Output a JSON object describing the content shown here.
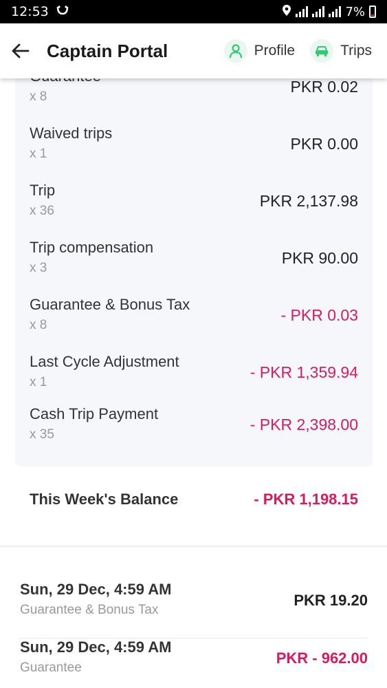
{
  "status_bar": {
    "time": "12:53",
    "battery": "7%"
  },
  "app_bar": {
    "title": "Captain Portal",
    "profile_label": "Profile",
    "trips_label": "Trips"
  },
  "breakdown": [
    {
      "label": "Guarantee",
      "count": "x 8",
      "amount": "PKR 0.02",
      "negative": false
    },
    {
      "label": "Waived trips",
      "count": "x 1",
      "amount": "PKR 0.00",
      "negative": false
    },
    {
      "label": "Trip",
      "count": "x 36",
      "amount": "PKR 2,137.98",
      "negative": false
    },
    {
      "label": "Trip compensation",
      "count": "x 3",
      "amount": "PKR 90.00",
      "negative": false
    },
    {
      "label": "Guarantee & Bonus Tax",
      "count": "x 8",
      "amount": "- PKR 0.03",
      "negative": true
    },
    {
      "label": "Last Cycle Adjustment",
      "count": "x 1",
      "amount": "- PKR 1,359.94",
      "negative": true
    },
    {
      "label": "Cash Trip Payment",
      "count": "x 35",
      "amount": "- PKR 2,398.00",
      "negative": true
    }
  ],
  "balance": {
    "label": "This Week's Balance",
    "amount": "- PKR 1,198.15"
  },
  "transactions": [
    {
      "date": "Sun, 29 Dec, 4:59 AM",
      "type": "Guarantee & Bonus Tax",
      "amount": "PKR 19.20",
      "negative": false
    },
    {
      "date": "Sun, 29 Dec, 4:59 AM",
      "type": "Guarantee",
      "amount": "PKR - 962.00",
      "negative": true
    }
  ],
  "colors": {
    "accent_green": "#2ecc71",
    "negative": "#d81b60",
    "card_bg": "#f5f7fa"
  }
}
